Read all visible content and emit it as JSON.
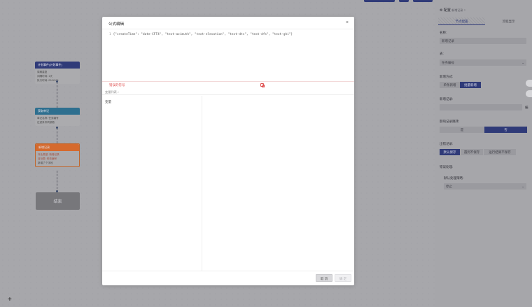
{
  "canvas": {
    "nodes": [
      {
        "title": "计划事件(计划事件)",
        "head_color": "#2f3a78",
        "lines": [
          "周期重复",
          "间隔时间: 1天",
          "执行时间: 00:00:00"
        ]
      },
      {
        "title": "获取单记",
        "head_color": "#2e6f8f",
        "lines": [
          "单记名称: 任务编号",
          "过滤条件同参数"
        ]
      },
      {
        "title": "新增记录",
        "head_color": "#d56a2d",
        "lines": [
          "作业类型: 新增记录",
          "目标表: 任务编号",
          "新增了个字段"
        ]
      }
    ],
    "end_label": "结束",
    "add_symbol": "+"
  },
  "right_panel": {
    "title": "配置",
    "subtitle": "新增记录",
    "help_symbol": "?",
    "tabs": [
      "节点配置",
      "流程显示"
    ],
    "name_label": "名称:",
    "name_value": "新增记录",
    "table_label": "表:",
    "table_value": "任务编号",
    "mode_label": "新增方式:",
    "mode_options": [
      "单条新增",
      "批量新增"
    ],
    "record_label": "新增记录:",
    "record_action": "编",
    "skip_label": "影响记录跳转:",
    "skip_options": [
      "是",
      "否"
    ],
    "error_label": "出错记录:",
    "error_options": [
      "默认保存",
      "遇到不保存",
      "运行结果不保存"
    ],
    "handle_label": "错误处理:",
    "strategy_label": "默认处理策略:",
    "strategy_value": "停止"
  },
  "modal": {
    "title": "公式编辑",
    "close_symbol": "×",
    "line_number": "1",
    "formula": "{\"createTime\": \"date-CFT4\", \"text-azimuth\", \"text-elevation\", \"text-dts\", \"text-dfs\", \"text-ghi\"}",
    "error_text": "错误的符号",
    "variable_list_label": "变量列表 ♪",
    "variable_item": "变量",
    "cancel_label": "取 消",
    "ok_label": "确 定"
  },
  "colors": {
    "primary": "#2f3a78",
    "error": "#e05050",
    "overlay": "#a9a9ad"
  }
}
